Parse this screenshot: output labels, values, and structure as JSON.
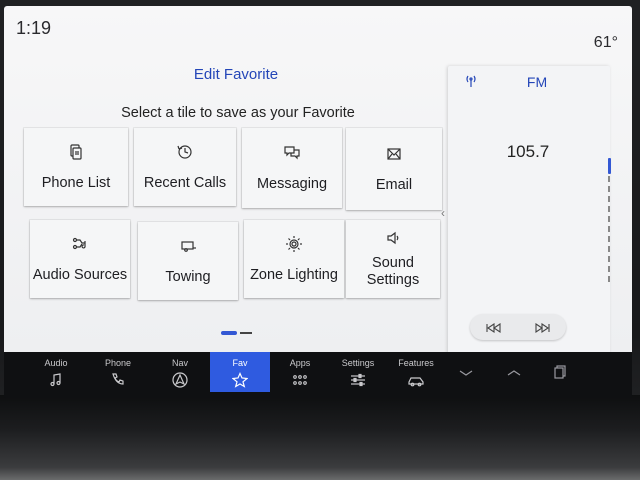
{
  "status": {
    "time": "1:19",
    "temperature": "61°"
  },
  "header": {
    "title": "Edit Favorite",
    "subtitle": "Select a tile to save as your Favorite"
  },
  "tiles": [
    {
      "label": "Phone List",
      "icon": "phone-list-icon"
    },
    {
      "label": "Recent Calls",
      "icon": "clock-icon"
    },
    {
      "label": "Messaging",
      "icon": "chat-bubbles-icon"
    },
    {
      "label": "Email",
      "icon": "envelope-icon"
    },
    {
      "label": "Audio Sources",
      "icon": "audio-sources-icon"
    },
    {
      "label": "Towing",
      "icon": "trailer-icon"
    },
    {
      "label": "Zone Lighting",
      "icon": "light-bulb-icon"
    },
    {
      "label": "Sound\nSettings",
      "icon": "speaker-icon"
    }
  ],
  "pagination": {
    "current_page": 1,
    "total_pages": 2
  },
  "radio": {
    "band": "FM",
    "frequency": "105.7",
    "signal_icon": "signal-icon",
    "prev_icon": "seek-back-icon",
    "next_icon": "seek-forward-icon"
  },
  "navbar": {
    "items": [
      {
        "label": "Audio",
        "icon": "music-note-icon",
        "active": false
      },
      {
        "label": "Phone",
        "icon": "phone-icon",
        "active": false
      },
      {
        "label": "Nav",
        "icon": "navigation-arrow-icon",
        "active": false
      },
      {
        "label": "Fav",
        "icon": "star-icon",
        "active": true
      },
      {
        "label": "Apps",
        "icon": "apps-grid-icon",
        "active": false
      },
      {
        "label": "Settings",
        "icon": "sliders-icon",
        "active": false
      },
      {
        "label": "Features",
        "icon": "car-icon",
        "active": false
      }
    ],
    "extra_icons": [
      "chevron-down-icon",
      "chevron-up-icon",
      "cards-icon"
    ]
  },
  "colors": {
    "accent": "#2f5be0",
    "title_text": "#2446b8",
    "background": "#f2f3f5",
    "navbar_bg": "#0f1012"
  }
}
